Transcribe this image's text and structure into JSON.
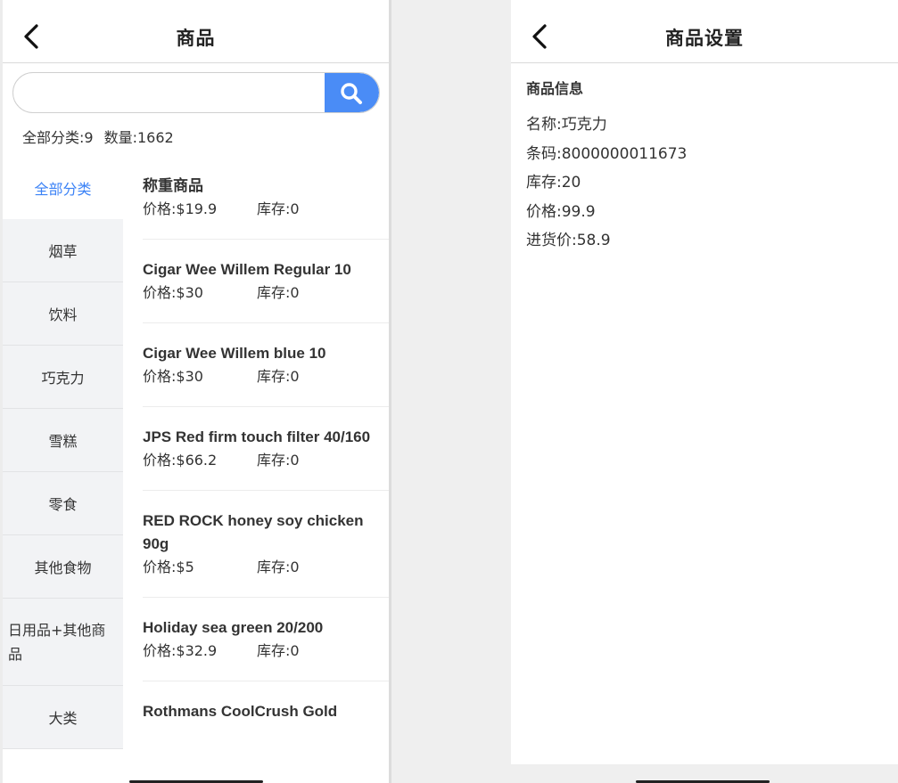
{
  "left": {
    "title": "商品",
    "search": {
      "placeholder": "",
      "value": ""
    },
    "stats": {
      "categories": "全部分类:9",
      "count": "数量:1662"
    },
    "categories": [
      {
        "label": "全部分类",
        "active": true
      },
      {
        "label": "烟草"
      },
      {
        "label": "饮料"
      },
      {
        "label": "巧克力"
      },
      {
        "label": "雪糕"
      },
      {
        "label": "零食"
      },
      {
        "label": "其他食物"
      },
      {
        "label": "日用品+其他商品"
      },
      {
        "label": "大类"
      }
    ],
    "products": [
      {
        "name": "称重商品",
        "price": "价格:$19.9",
        "stock": "库存:0"
      },
      {
        "name": "Cigar Wee Willem Regular 10",
        "price": "价格:$30",
        "stock": "库存:0"
      },
      {
        "name": "Cigar Wee Willem blue 10",
        "price": "价格:$30",
        "stock": "库存:0"
      },
      {
        "name": "JPS Red firm touch filter 40/160",
        "price": "价格:$66.2",
        "stock": "库存:0"
      },
      {
        "name": "RED ROCK honey soy chicken 90g",
        "price": "价格:$5",
        "stock": "库存:0"
      },
      {
        "name": "Holiday sea green 20/200",
        "price": "价格:$32.9",
        "stock": "库存:0"
      },
      {
        "name": "Rothmans CoolCrush Gold",
        "price": "",
        "stock": ""
      }
    ]
  },
  "right": {
    "title": "商品设置",
    "section": "商品信息",
    "info": {
      "name": "名称:巧克力",
      "barcode": "条码:8000000011673",
      "stock": "库存:20",
      "price": "价格:99.9",
      "cost": "进货价:58.9"
    }
  },
  "icons": {
    "back": "chevron-left-icon",
    "search": "search-icon"
  },
  "colors": {
    "accent": "#4a8cf6",
    "active_category": "#3b82f6"
  }
}
